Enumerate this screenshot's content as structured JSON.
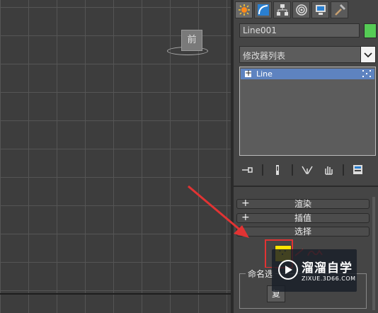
{
  "viewport": {
    "view_label": "前"
  },
  "command_panel": {
    "tabs": [
      {
        "icon": "create-sun-icon",
        "active": true
      },
      {
        "icon": "modify-arc-icon",
        "active": false
      },
      {
        "icon": "hierarchy-icon",
        "active": false
      },
      {
        "icon": "motion-icon",
        "active": false
      },
      {
        "icon": "display-icon",
        "active": false
      },
      {
        "icon": "utilities-hammer-icon",
        "active": false
      }
    ],
    "object_name": "Line001",
    "object_color": "#55cc55",
    "modifier_list": "修改器列表",
    "stack": {
      "items": [
        {
          "label": "Line"
        }
      ]
    },
    "rollouts": [
      {
        "sign": "+",
        "title": "渲染"
      },
      {
        "sign": "+",
        "title": "插值"
      },
      {
        "sign": "",
        "title": "选择"
      }
    ],
    "named_selection": {
      "legend": "命名选",
      "button": "复"
    }
  },
  "watermark": {
    "title": "溜溜自学",
    "url": "ZIXUE.3D66.COM"
  }
}
